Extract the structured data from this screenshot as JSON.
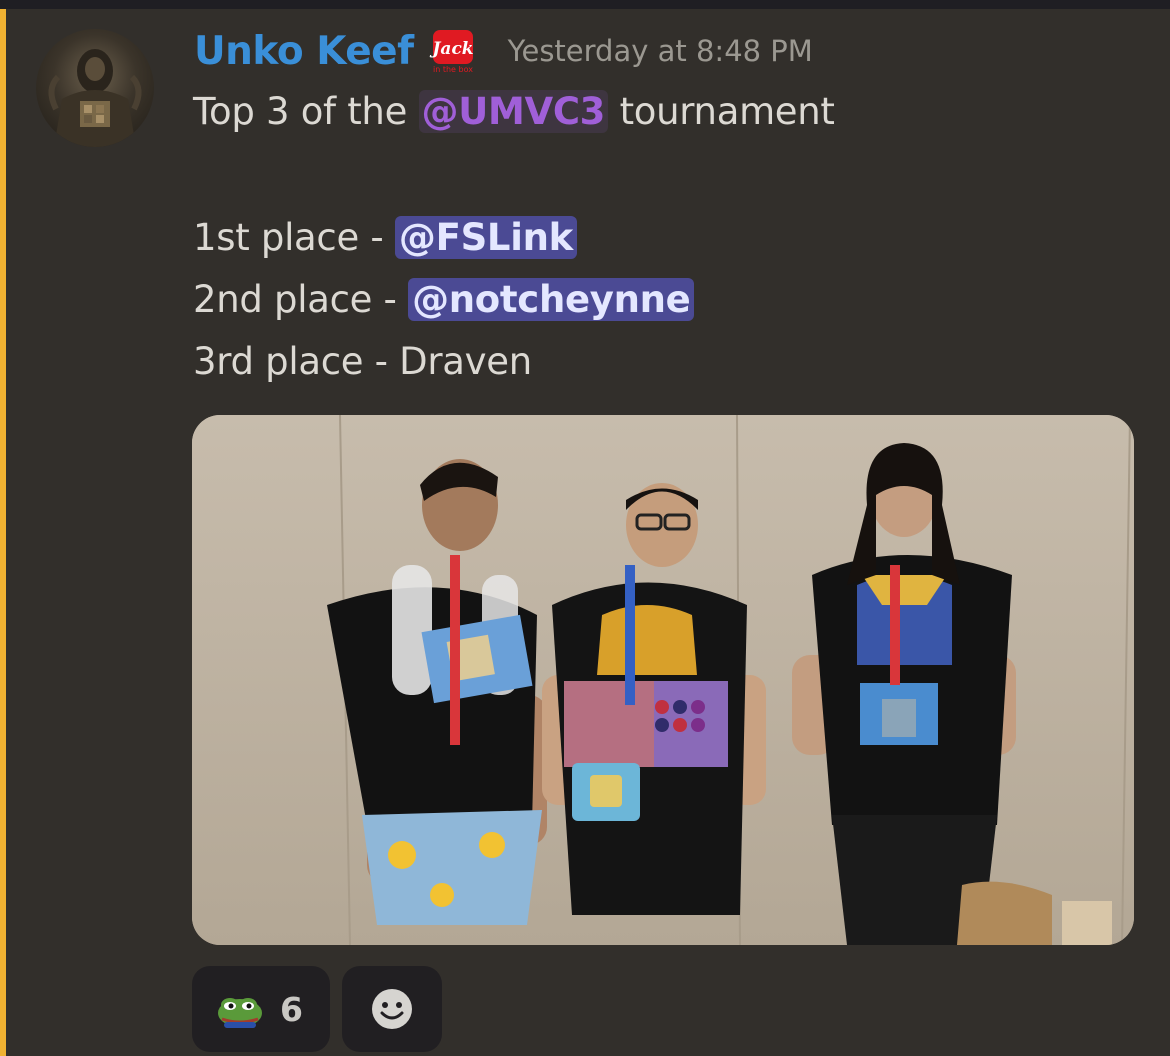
{
  "message": {
    "author": "Unko Keef",
    "author_color": "#3a8fd8",
    "badge_icon": "jack-in-the-box-icon",
    "badge_text": "Jack",
    "badge_subtext": "in the box",
    "timestamp": "Yesterday at 8:48 PM",
    "line1_prefix": "Top 3 of the ",
    "role_mention": "@UMVC3",
    "line1_suffix": " tournament",
    "places": [
      {
        "prefix": "1st place - ",
        "mention": "@FSLink"
      },
      {
        "prefix": "2nd place - ",
        "mention": "@notcheynne"
      },
      {
        "prefix": "3rd place - ",
        "text": "Draven"
      }
    ],
    "image_alt": "Three tournament winners posing with prizes"
  },
  "reactions": [
    {
      "emoji_icon": "pepe-frog-icon",
      "count": "6"
    }
  ],
  "add_reaction_icon": "smiley-face-icon",
  "colors": {
    "highlight_bar": "#f0b232",
    "role_mention": "#a05fd8",
    "user_mention_bg": "#4b4a94",
    "background": "#322f2b"
  }
}
